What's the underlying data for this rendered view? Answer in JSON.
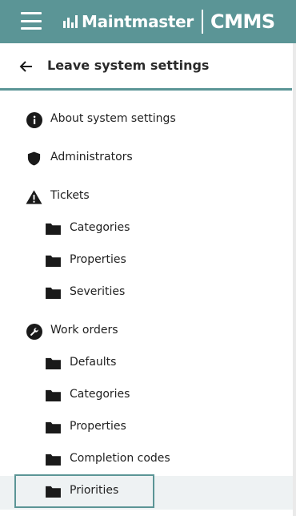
{
  "header": {
    "brand_name": "Maintmaster",
    "product": "CMMS",
    "icons": {
      "menu": "hamburger-menu-icon",
      "logo": "maintmaster-logo-icon"
    },
    "bar_color": "#5b9596"
  },
  "back": {
    "label": "Leave system settings",
    "icon": "arrow-left-icon"
  },
  "menu": [
    {
      "label": "About system settings",
      "icon": "info-icon",
      "level": 0
    },
    {
      "label": "Administrators",
      "icon": "shield-icon",
      "level": 0
    },
    {
      "label": "Tickets",
      "icon": "warning-icon",
      "level": 0
    },
    {
      "label": "Categories",
      "icon": "folder-icon",
      "level": 1
    },
    {
      "label": "Properties",
      "icon": "folder-icon",
      "level": 1
    },
    {
      "label": "Severities",
      "icon": "folder-icon",
      "level": 1
    },
    {
      "label": "Work orders",
      "icon": "wrench-icon",
      "level": 0
    },
    {
      "label": "Defaults",
      "icon": "folder-icon",
      "level": 1
    },
    {
      "label": "Categories",
      "icon": "folder-icon",
      "level": 1
    },
    {
      "label": "Properties",
      "icon": "folder-icon",
      "level": 1
    },
    {
      "label": "Completion codes",
      "icon": "folder-icon",
      "level": 1
    },
    {
      "label": "Priorities",
      "icon": "folder-icon",
      "level": 1,
      "selected": true
    }
  ],
  "colors": {
    "accent": "#5b9596",
    "selected_bg": "#eef2f3",
    "icon": "#1a1a1a"
  }
}
